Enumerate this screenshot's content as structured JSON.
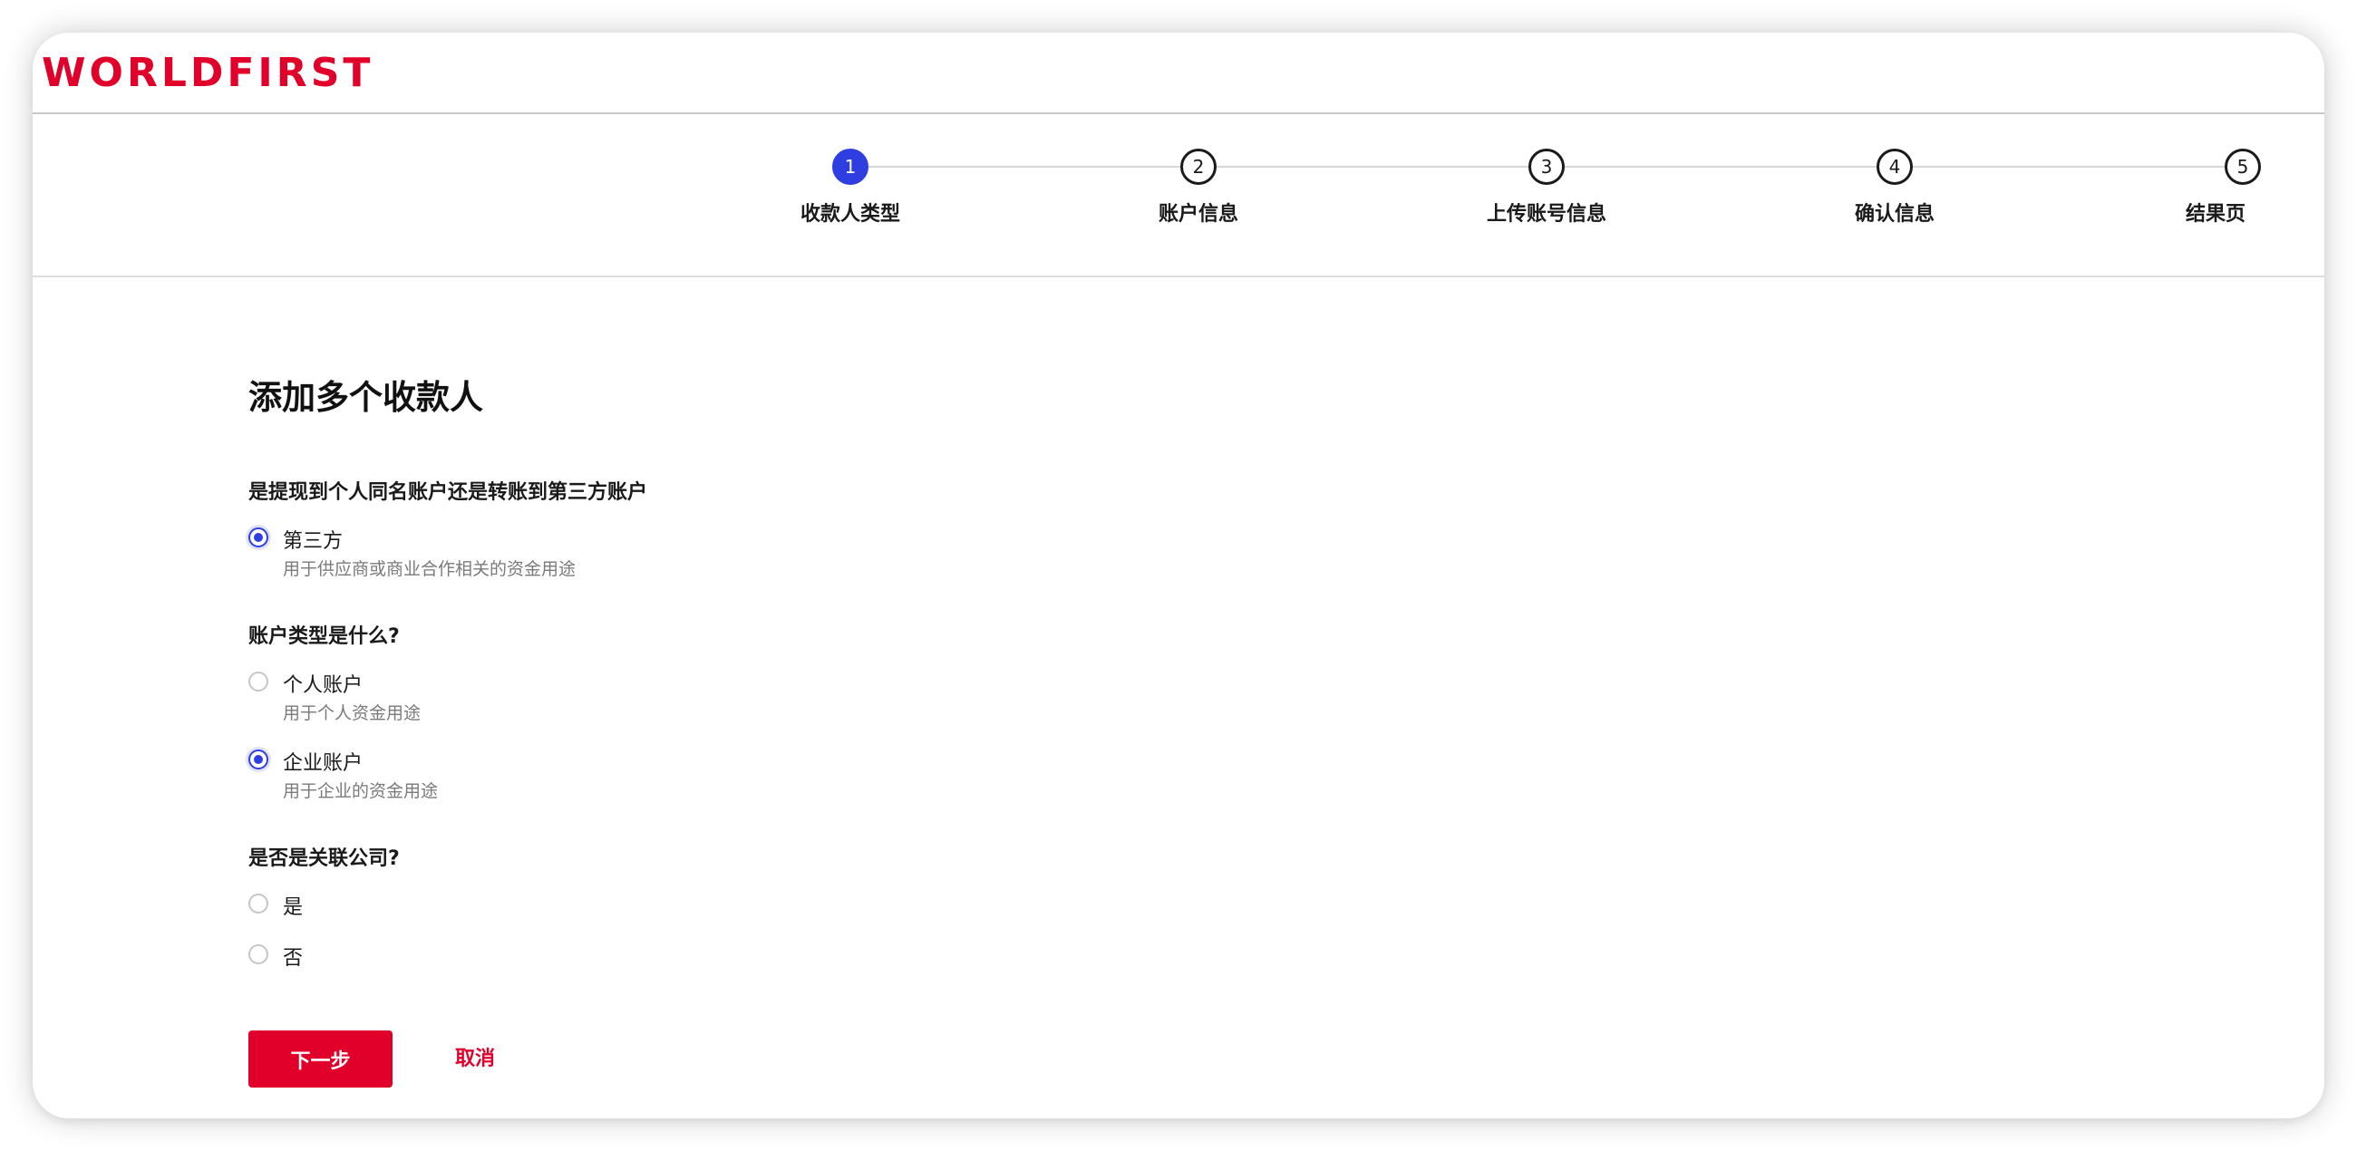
{
  "brand": {
    "logo_text": "WORLDFIRST",
    "color": "#e0002a"
  },
  "stepper": {
    "active_color": "#2f3ee0",
    "steps": [
      {
        "number": "1",
        "label": "收款人类型",
        "active": true
      },
      {
        "number": "2",
        "label": "账户信息",
        "active": false
      },
      {
        "number": "3",
        "label": "上传账号信息",
        "active": false
      },
      {
        "number": "4",
        "label": "确认信息",
        "active": false
      },
      {
        "number": "5",
        "label": "结果页",
        "active": false
      }
    ]
  },
  "form": {
    "title": "添加多个收款人",
    "q1": {
      "question": "是提现到个人同名账户还是转账到第三方账户",
      "options": [
        {
          "label": "第三方",
          "desc": "用于供应商或商业合作相关的资金用途",
          "selected": true
        }
      ]
    },
    "q2": {
      "question": "账户类型是什么?",
      "options": [
        {
          "label": "个人账户",
          "desc": "用于个人资金用途",
          "selected": false
        },
        {
          "label": "企业账户",
          "desc": "用于企业的资金用途",
          "selected": true
        }
      ]
    },
    "q3": {
      "question": "是否是关联公司?",
      "options": [
        {
          "label": "是",
          "selected": false
        },
        {
          "label": "否",
          "selected": false
        }
      ]
    },
    "actions": {
      "next_label": "下一步",
      "cancel_label": "取消"
    }
  }
}
